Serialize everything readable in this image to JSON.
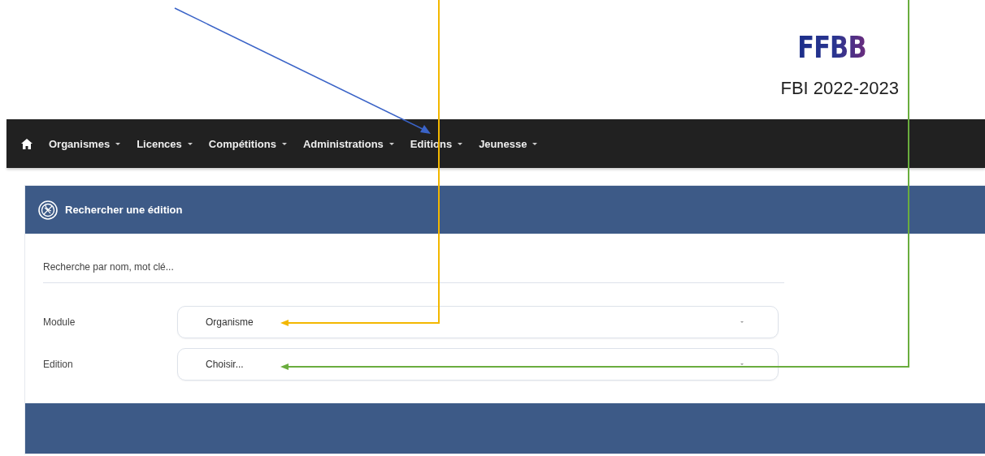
{
  "logo": {
    "text": "FFBB"
  },
  "subtitle": "FBI 2022-2023",
  "nav": {
    "items": [
      {
        "label": "Organismes"
      },
      {
        "label": "Licences"
      },
      {
        "label": "Compétitions"
      },
      {
        "label": "Administrations"
      },
      {
        "label": "Editions"
      },
      {
        "label": "Jeunesse"
      }
    ]
  },
  "panel": {
    "title": "Rechercher une édition",
    "search": {
      "placeholder": "Recherche par nom, mot clé..."
    },
    "fields": [
      {
        "label": "Module",
        "value": "Organisme"
      },
      {
        "label": "Edition",
        "value": "Choisir..."
      }
    ]
  }
}
